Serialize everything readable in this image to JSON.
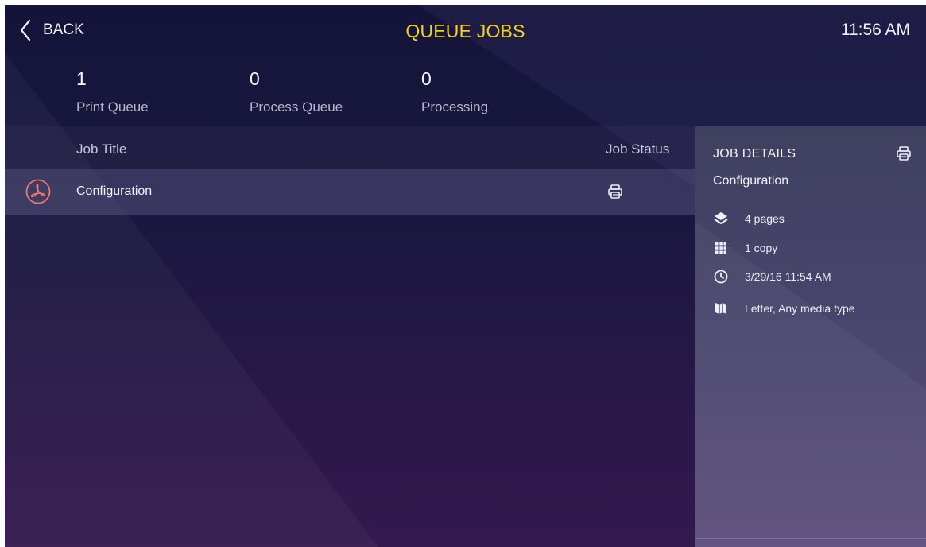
{
  "header": {
    "back_label": "BACK",
    "title": "QUEUE JOBS",
    "time": "11:56 AM"
  },
  "stats": [
    {
      "value": "1",
      "label": "Print Queue"
    },
    {
      "value": "0",
      "label": "Process Queue"
    },
    {
      "value": "0",
      "label": "Processing"
    }
  ],
  "list": {
    "col_title": "Job Title",
    "col_status": "Job Status",
    "jobs": [
      {
        "title": "Configuration",
        "file_icon": "pdf-icon",
        "status_icon": "printer-icon"
      }
    ]
  },
  "details": {
    "title": "JOB DETAILS",
    "job_name": "Configuration",
    "pages": "4 pages",
    "copies": "1 copy",
    "date": "3/29/16 11:54 AM",
    "media": "Letter, Any media type",
    "icons": [
      "layers-icon",
      "grid-icon",
      "clock-icon",
      "media-icon",
      "printer-icon"
    ]
  },
  "colors": {
    "title_accent": "#f3d21a",
    "pdf_accent": "#e8796f",
    "background": "#14143a"
  }
}
